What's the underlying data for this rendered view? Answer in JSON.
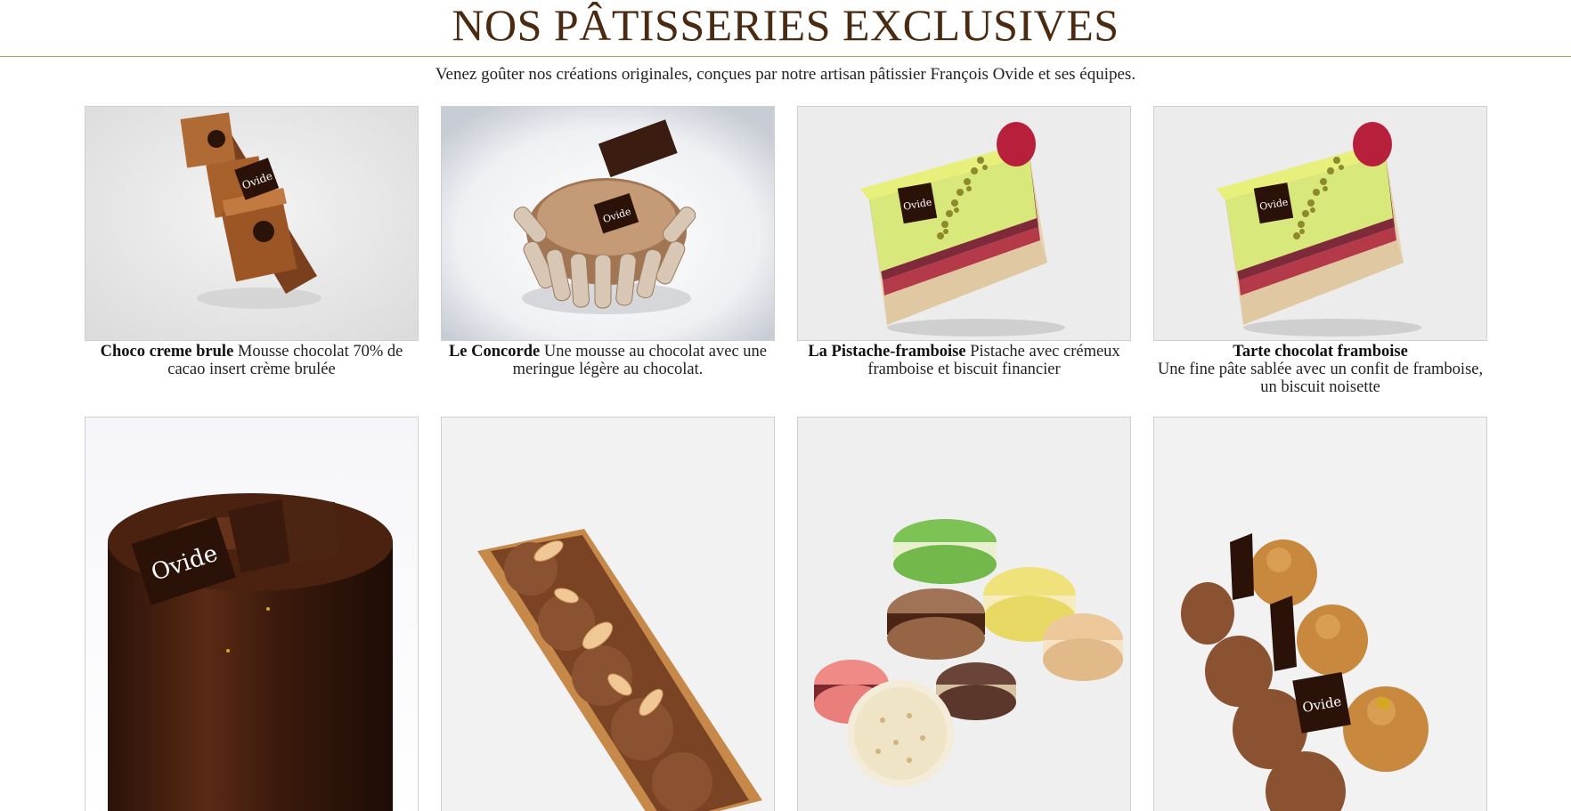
{
  "header": {
    "title": "NOS PÂTISSERIES EXCLUSIVES",
    "intro": "Venez goûter nos créations originales, conçues par notre artisan pâtissier François Ovide et ses équipes."
  },
  "colors": {
    "title": "#4a2a10",
    "rule": "#9ab24a",
    "text": "#222222"
  },
  "products": [
    {
      "name": "Choco creme brule",
      "description": "Mousse chocolat 70% de cacao insert crème brulée",
      "image": "chocolate-dessert-photo"
    },
    {
      "name": "Le Concorde",
      "description": "Une mousse au chocolat avec une meringue légère au chocolat.",
      "image": "concorde-cake-photo"
    },
    {
      "name": "La Pistache-framboise",
      "description": "Pistache avec crémeux framboise et biscuit financier",
      "image": "pistachio-raspberry-cake-photo"
    },
    {
      "name": "Tarte chocolat framboise",
      "description": "Une fine pâte sablée avec un confit de framboise, un biscuit noisette",
      "image": "pistachio-raspberry-cake-photo"
    }
  ],
  "gallery_row2": [
    {
      "image": "glazed-chocolate-entremet-photo"
    },
    {
      "image": "chocolate-almond-eclair-tart-photo"
    },
    {
      "image": "macarons-stack-photo"
    },
    {
      "image": "choux-chocolate-tart-photo"
    }
  ]
}
